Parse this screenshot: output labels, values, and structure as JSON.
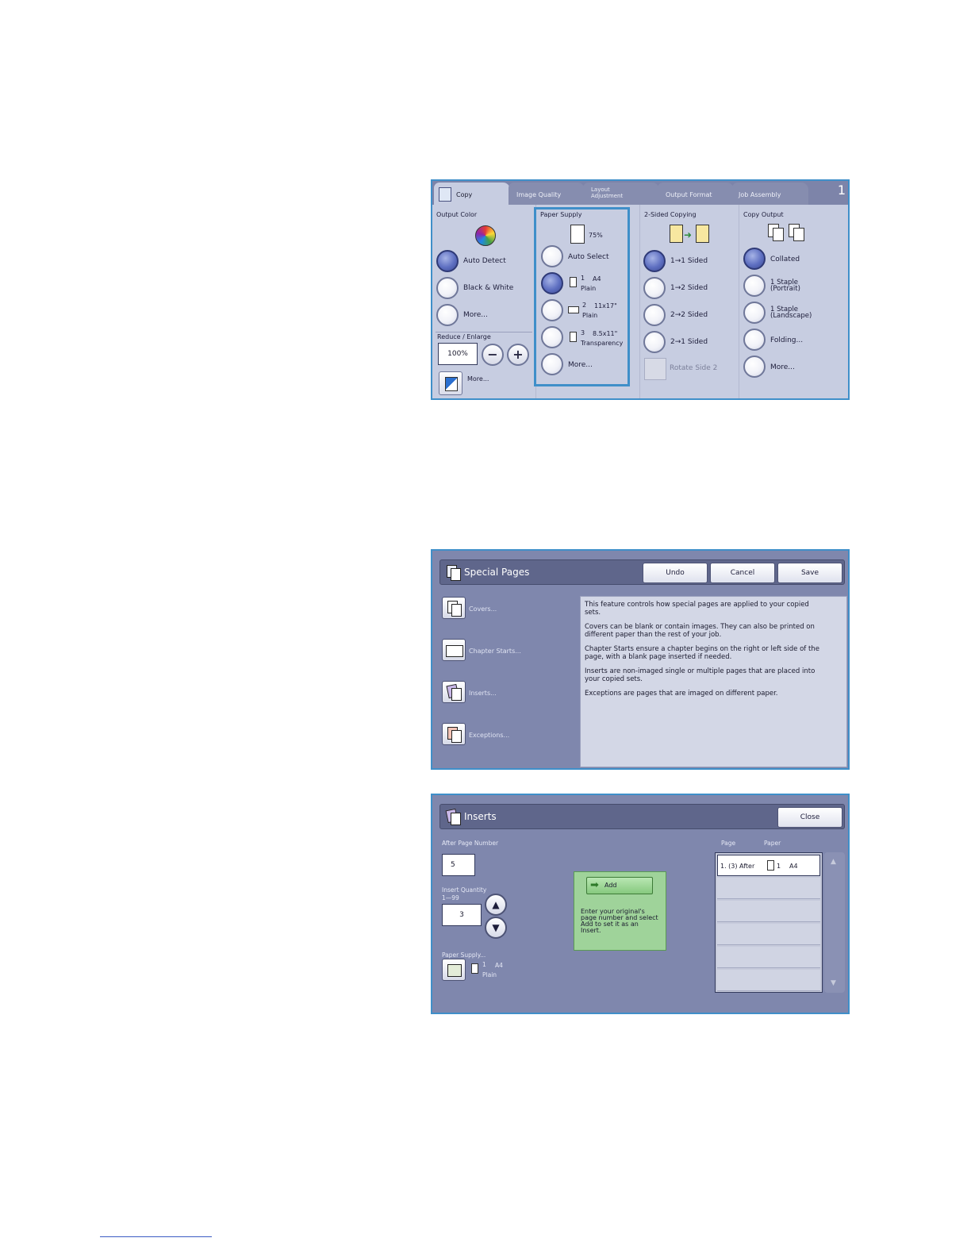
{
  "copy_screen": {
    "tabs": [
      {
        "label": "Copy"
      },
      {
        "label": "Image Quality"
      },
      {
        "label_line1": "Layout",
        "label_line2": "Adjustment"
      },
      {
        "label": "Output Format"
      },
      {
        "label": "Job Assembly"
      }
    ],
    "tab_count": "1",
    "output_color": {
      "title": "Output Color",
      "options": [
        "Auto Detect",
        "Black & White",
        "More..."
      ],
      "selected": "Auto Detect"
    },
    "reduce_enlarge": {
      "title": "Reduce / Enlarge",
      "value": "100%",
      "minus": "−",
      "plus": "+",
      "more": "More..."
    },
    "paper_supply": {
      "title": "Paper Supply",
      "ratio": "75%",
      "options": [
        {
          "tray": "",
          "label_line1": "Auto Select",
          "label_line2": ""
        },
        {
          "tray": "1",
          "label_line1": "A4",
          "label_line2": "Plain"
        },
        {
          "tray": "2",
          "label_line1": "11x17\"",
          "label_line2": "Plain"
        },
        {
          "tray": "3",
          "label_line1": "8.5x11\"",
          "label_line2": "Transparency"
        },
        {
          "tray": "",
          "label_line1": "More...",
          "label_line2": ""
        }
      ],
      "selected": "1"
    },
    "two_sided": {
      "title": "2-Sided Copying",
      "options": [
        "1→1 Sided",
        "1→2 Sided",
        "2→2 Sided",
        "2→1 Sided"
      ],
      "selected": "1→1 Sided",
      "rotate": "Rotate Side 2"
    },
    "copy_output": {
      "title": "Copy Output",
      "options": [
        {
          "line1": "Collated",
          "line2": ""
        },
        {
          "line1": "1 Staple",
          "line2": "(Portrait)"
        },
        {
          "line1": "1 Staple",
          "line2": "(Landscape)"
        },
        {
          "line1": "Folding...",
          "line2": ""
        },
        {
          "line1": "More...",
          "line2": ""
        }
      ],
      "selected": "Collated"
    }
  },
  "special_pages": {
    "title": "Special Pages",
    "buttons": {
      "undo": "Undo",
      "cancel": "Cancel",
      "save": "Save"
    },
    "items": [
      "Covers...",
      "Chapter Starts...",
      "Inserts...",
      "Exceptions..."
    ],
    "info": [
      "This feature controls how special pages are applied to your copied sets.",
      "Covers can be blank or contain images. They can also be printed on different paper than the rest of your job.",
      "Chapter Starts  ensure a chapter begins on the right or left side of the page, with a blank page inserted if needed.",
      "Inserts  are non-imaged single or multiple pages that are placed into your copied sets.",
      "Exceptions  are pages that are imaged on different paper."
    ]
  },
  "inserts": {
    "title": "Inserts",
    "close": "Close",
    "after_page_label": "After Page Number",
    "after_page_value": "5",
    "quantity_label": "Insert Quantity",
    "quantity_range": "1—99",
    "quantity_value": "3",
    "paper_supply_label": "Paper Supply...",
    "paper_tray": "1",
    "paper_size": "A4",
    "paper_type": "Plain",
    "add_label": "Add",
    "add_help": "Enter your original's page number and select Add to set it as an Insert.",
    "list_headers": {
      "page": "Page",
      "paper": "Paper"
    },
    "list_rows": [
      {
        "page": "1. (3) After",
        "tray": "1",
        "paper": "A4"
      }
    ]
  },
  "colors": {
    "accent_border": "#3f8fc9",
    "panel_bg": "#7f87ad",
    "selected_radio": "#5e6fc1",
    "insert_help_bg": "#9fd39a"
  }
}
